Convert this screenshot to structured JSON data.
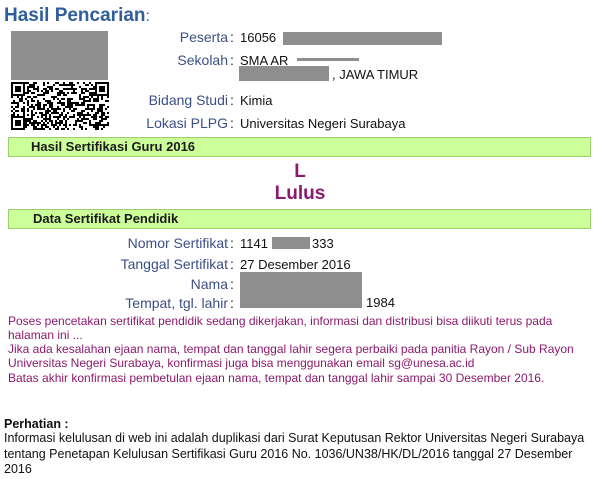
{
  "page": {
    "title": "Hasil Pencarian",
    "title_colon": ":"
  },
  "peserta": {
    "photo_icon": "redacted-photo",
    "qr_icon": "qr-code",
    "fields": {
      "peserta_label": "Peserta",
      "peserta_value": "16056",
      "sekolah_label": "Sekolah",
      "sekolah_value_line1": "SMA AR",
      "sekolah_value_line2": ", JAWA TIMUR",
      "bidang_label": "Bidang Studi",
      "bidang_value": "Kimia",
      "lokasi_label": "Lokasi PLPG",
      "lokasi_value": "Universitas Negeri Surabaya"
    },
    "separator": ":"
  },
  "hasil": {
    "band_label": "Hasil Sertifikasi Guru 2016",
    "code": "L",
    "status": "Lulus"
  },
  "sertifikat": {
    "band_label": "Data Sertifikat Pendidik",
    "nomor_label": "Nomor Sertifikat",
    "nomor_value_start": "1141",
    "nomor_value_end": "333",
    "tanggal_label": "Tanggal Sertifikat",
    "tanggal_value": "27 Desember 2016",
    "nama_label": "Nama",
    "ttl_label": "Tempat, tgl. lahir",
    "ttl_value_end": "1984"
  },
  "notices": {
    "line1": "Poses pencetakan sertifikat pendidik sedang dikerjakan, informasi dan distribusi bisa diikuti terus pada halaman ini ...",
    "line2": "Jika ada kesalahan ejaan nama, tempat dan tanggal lahir segera perbaiki pada panitia Rayon / Sub Rayon Universitas Negeri Surabaya, konfirmasi juga bisa menggunakan email sg@unesa.ac.id",
    "line3": "Batas akhir konfirmasi pembetulan ejaan nama, tempat dan tanggal lahir sampai 30 Desember 2016."
  },
  "perhatian": {
    "heading": "Perhatian :",
    "body": "Informasi kelulusan di web ini adalah duplikasi dari Surat Keputusan Rektor Universitas Negeri Surabaya tentang Penetapan Kelulusan Sertifikasi Guru 2016 No. 1036/UN38/HK/DL/2016 tanggal 27 Desember 2016"
  },
  "colors": {
    "title": "#2f5f9a",
    "label": "#3c4f86",
    "band_bg": "#ccff99",
    "result": "#8c1a6c",
    "redaction": "#8e8e8e"
  }
}
